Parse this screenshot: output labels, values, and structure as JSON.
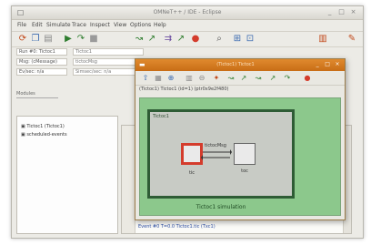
{
  "window": {
    "title": "OMNeT++ / IDE - Eclipse",
    "controls": [
      "_",
      "□",
      "×"
    ]
  },
  "menu": [
    "File",
    "Edit",
    "Simulate",
    "Trace",
    "Inspect",
    "View",
    "Options",
    "Help"
  ],
  "fields": [
    {
      "label": "Run #0: Tictoc1",
      "value": "Tictoc1"
    },
    {
      "label": "Msg: (cMessage)",
      "value": "tictocMsg"
    },
    {
      "label": "Ev/sec: n/a",
      "value": "Simsec/sec: n/a"
    }
  ],
  "panel_tab": "Modules",
  "tree": [
    "Tictoc1 (Tictoc1)",
    "scheduled-events"
  ],
  "editor_tail": "Event #0  T=0.0  Tictoc1.tic (Txc1)",
  "sim": {
    "title": "(Tictoc1) Tictoc1",
    "path": "(Tictoc1) Tictoc1  (id=1)  (ptr0x9e2f480)",
    "frame_label": "Tictoc1",
    "node_tic": "tic",
    "node_toc": "toc",
    "connection_label": "tictocMsg",
    "caption": "Tictoc1 simulation"
  },
  "colors": {
    "accent": "#d9822b",
    "canvas": "#8cc88c",
    "frame": "#2e5c35",
    "node_highlight": "#d43c2c",
    "code": "#2c4ea6"
  }
}
